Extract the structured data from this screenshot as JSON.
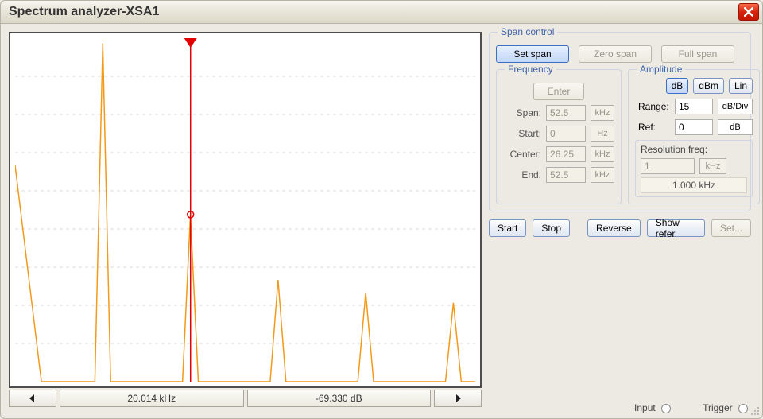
{
  "title": "Spectrum analyzer-XSA1",
  "readout": {
    "freq": "20.014 kHz",
    "amp": "-69.330  dB"
  },
  "span_control": {
    "legend": "Span control",
    "set_span": "Set span",
    "zero_span": "Zero span",
    "full_span": "Full span"
  },
  "frequency": {
    "legend": "Frequency",
    "enter": "Enter",
    "labels": {
      "span": "Span:",
      "start": "Start:",
      "center": "Center:",
      "end": "End:"
    },
    "span": {
      "val": "52.5",
      "unit": "kHz"
    },
    "start": {
      "val": "0",
      "unit": "Hz"
    },
    "center": {
      "val": "26.25",
      "unit": "kHz"
    },
    "end": {
      "val": "52.5",
      "unit": "kHz"
    }
  },
  "amplitude": {
    "legend": "Amplitude",
    "db": "dB",
    "dbm": "dBm",
    "lin": "Lin",
    "range_label": "Range:",
    "range_val": "15",
    "range_unit": "dB/Div",
    "ref_label": "Ref:",
    "ref_val": "0",
    "ref_unit": "dB",
    "res_label": "Resolution freq:",
    "res_in": "1",
    "res_in_unit": "kHz",
    "res_val": "1.000 kHz"
  },
  "actions": {
    "start": "Start",
    "stop": "Stop",
    "reverse": "Reverse",
    "showref": "Show refer.",
    "set": "Set..."
  },
  "footer": {
    "input": "Input",
    "trigger": "Trigger"
  },
  "chart_data": {
    "type": "line",
    "title": "",
    "xlabel": "",
    "ylabel": "",
    "xlim": [
      0,
      52.5
    ],
    "xunit": "kHz",
    "ylim": [
      -135,
      0
    ],
    "yunit": "dB",
    "ydiv": 15,
    "marker": {
      "x": 20.014,
      "y": -69.33
    },
    "floor": -135,
    "peaks_khz_db": [
      {
        "x": 0,
        "y": -50
      },
      {
        "x": 10,
        "y": -2
      },
      {
        "x": 20,
        "y": -69.33
      },
      {
        "x": 30,
        "y": -95
      },
      {
        "x": 40,
        "y": -100
      },
      {
        "x": 50,
        "y": -104
      }
    ],
    "peak_half_width_khz": 0.9,
    "left_tail": {
      "decay_to_khz": 3.0
    }
  }
}
